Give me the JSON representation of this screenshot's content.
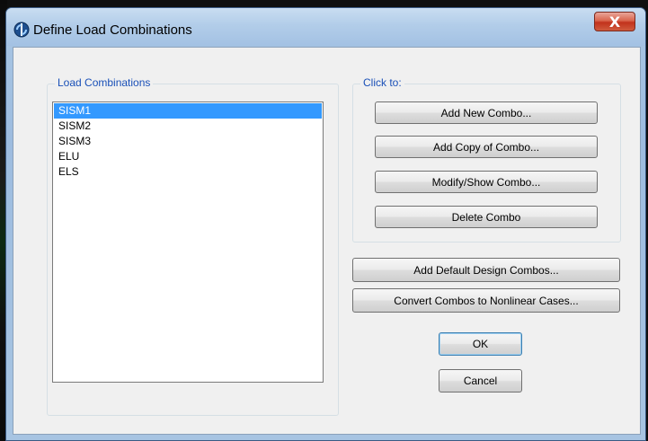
{
  "window": {
    "title": "Define Load Combinations",
    "close_label": "X"
  },
  "load_combinations": {
    "label": "Load Combinations",
    "items": [
      "SISM1",
      "SISM2",
      "SISM3",
      "ELU",
      "ELS"
    ],
    "selected": "SISM1"
  },
  "click_to": {
    "label": "Click to:",
    "buttons": [
      "Add New Combo...",
      "Add Copy of Combo...",
      "Modify/Show Combo...",
      "Delete Combo"
    ]
  },
  "actions": {
    "add_default": "Add Default Design Combos...",
    "convert": "Convert Combos to Nonlinear Cases...",
    "ok": "OK",
    "cancel": "Cancel"
  },
  "colors": {
    "selection": "#3399ff",
    "group_label": "#1a50b8",
    "close_button": "#c2321c"
  }
}
